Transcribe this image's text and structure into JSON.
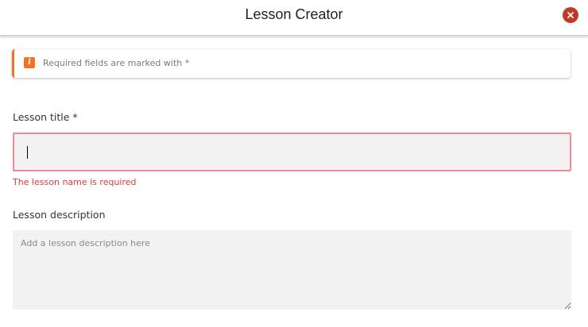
{
  "header": {
    "title": "Lesson Creator",
    "close_icon": "close-circle-icon",
    "close_color": "#c0392b"
  },
  "notice": {
    "icon": "info-icon",
    "icon_glyph": "i",
    "accent_color": "#f07427",
    "text": "Required fields are marked with *"
  },
  "form": {
    "title_label": "Lesson title *",
    "title_value": "",
    "title_error": "The lesson name is required",
    "error_color": "#e0383e",
    "description_label": "Lesson description",
    "description_placeholder": "Add a lesson description here",
    "description_value": ""
  }
}
